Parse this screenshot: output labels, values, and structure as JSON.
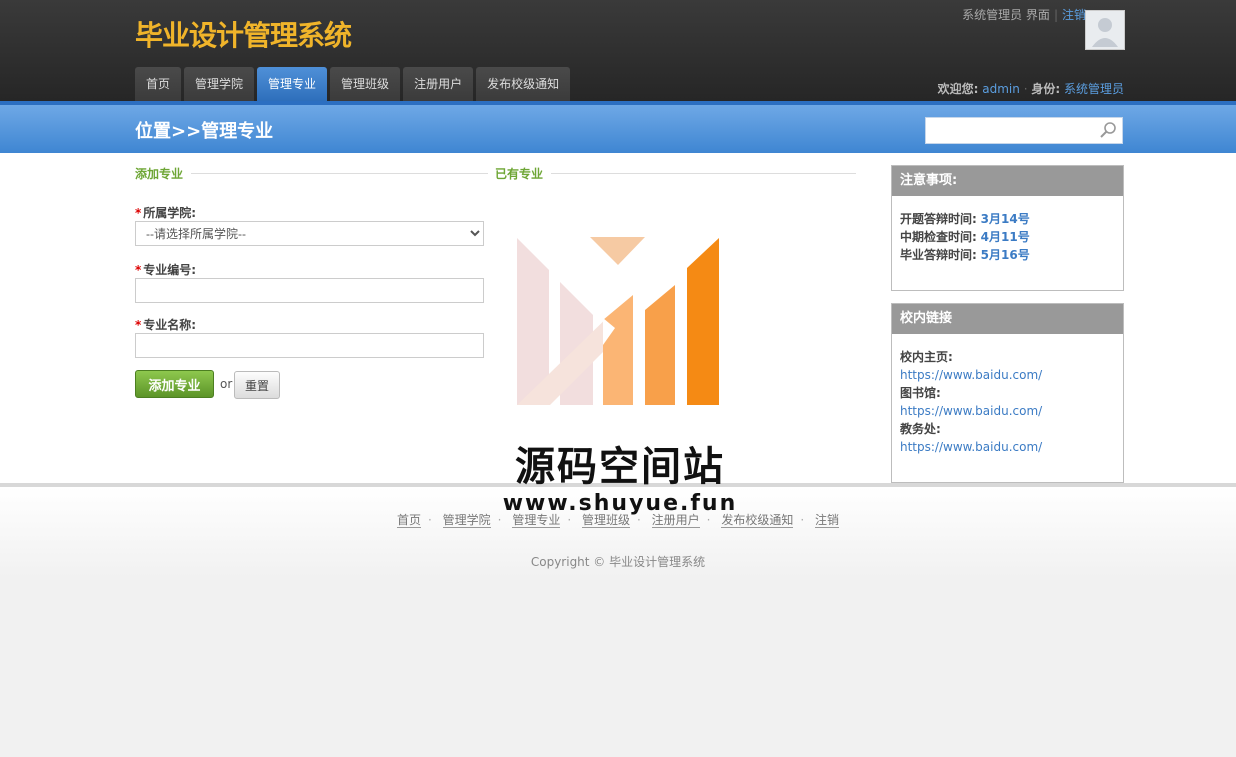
{
  "header": {
    "title": "毕业设计管理系统",
    "role_text": "系统管理员 界面",
    "logout": "注销",
    "welcome_label": "欢迎您:",
    "username": "admin",
    "identity_label": "身份:",
    "identity_value": "系统管理员"
  },
  "nav": {
    "items": [
      {
        "label": "首页",
        "active": false
      },
      {
        "label": "管理学院",
        "active": false
      },
      {
        "label": "管理专业",
        "active": true
      },
      {
        "label": "管理班级",
        "active": false
      },
      {
        "label": "注册用户",
        "active": false
      },
      {
        "label": "发布校级通知",
        "active": false
      }
    ]
  },
  "locbar": {
    "title": "位置>>管理专业",
    "search_placeholder": ""
  },
  "main": {
    "add_section": "添加专业",
    "existing_section": "已有专业",
    "college_label": "所属学院:",
    "college_selected": "--请选择所属学院--",
    "major_code_label": "专业编号:",
    "major_code_value": "",
    "major_name_label": "专业名称:",
    "major_name_value": "",
    "add_button": "添加专业",
    "or_text": "or",
    "reset_button": "重置"
  },
  "notice_panel": {
    "title": "注意事项:",
    "items": [
      {
        "label": "开题答辩时间:",
        "value": "3月14号"
      },
      {
        "label": "中期检查时间:",
        "value": "4月11号"
      },
      {
        "label": "毕业答辩时间:",
        "value": "5月16号"
      }
    ]
  },
  "links_panel": {
    "title": "校内链接",
    "items": [
      {
        "label": "校内主页:",
        "url": "https://www.baidu.com/"
      },
      {
        "label": "图书馆:",
        "url": "https://www.baidu.com/"
      },
      {
        "label": "教务处:",
        "url": "https://www.baidu.com/"
      }
    ]
  },
  "watermark": {
    "text": "源码空间站",
    "url": "www.shuyue.fun"
  },
  "footer": {
    "links": [
      "首页",
      "管理学院",
      "管理专业",
      "管理班级",
      "注册用户",
      "发布校级通知",
      "注销"
    ],
    "copyright": "Copyright © 毕业设计管理系统"
  },
  "colors": {
    "accent": "#3f86d2",
    "title": "#f0b42a",
    "green_button": "#6ea635"
  }
}
